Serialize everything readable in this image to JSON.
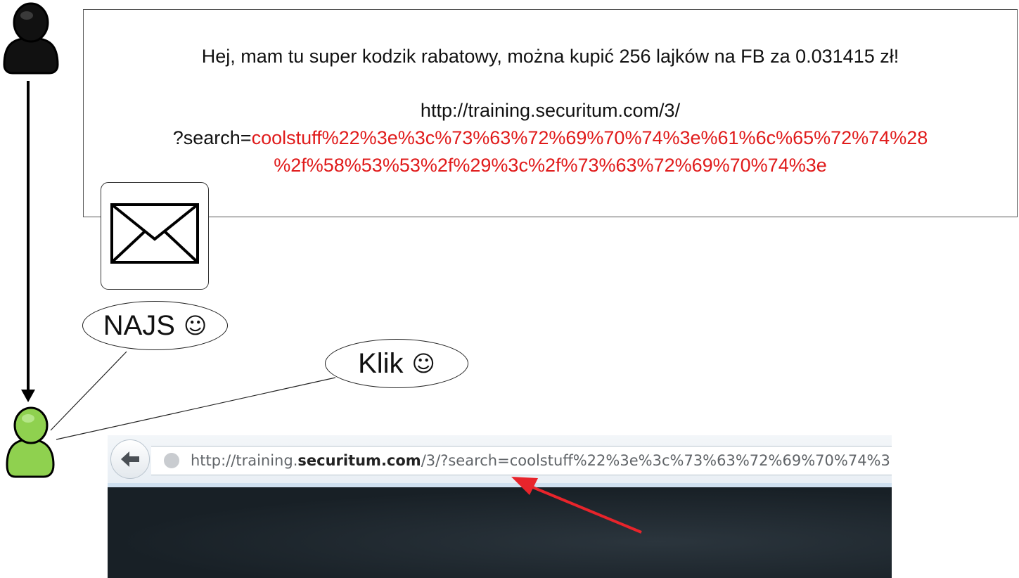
{
  "message": {
    "greeting": "Hej, mam tu super kodzik rabatowy, można kupić 256 lajków na FB za 0.031415 zł!",
    "url_base": "http://training.securitum.com/3/",
    "url_query_prefix": "?search=",
    "payload_part1": "coolstuff%22%3e%3c%73%63%72%69%70%74%3e%61%6c%65%72%74%28",
    "payload_part2": "%2f%58%53%53%2f%29%3c%2f%73%63%72%69%70%74%3e"
  },
  "bubbles": {
    "najs": "NAJS",
    "klik": "Klik",
    "smiley": "☺"
  },
  "browser": {
    "url_prefix": "http://training.",
    "url_domain": "securitum.com",
    "url_rest": "/3/?search=coolstuff%22%3e%3c%73%63%72%69%70%74%3"
  },
  "colors": {
    "attacker": "#000000",
    "victim": "#8fd14f",
    "payload": "#e01b1b",
    "arrow": "#e8242b"
  },
  "icons": {
    "attacker": "person-icon",
    "victim": "person-icon",
    "mail": "envelope-icon",
    "back": "back-arrow-icon"
  }
}
